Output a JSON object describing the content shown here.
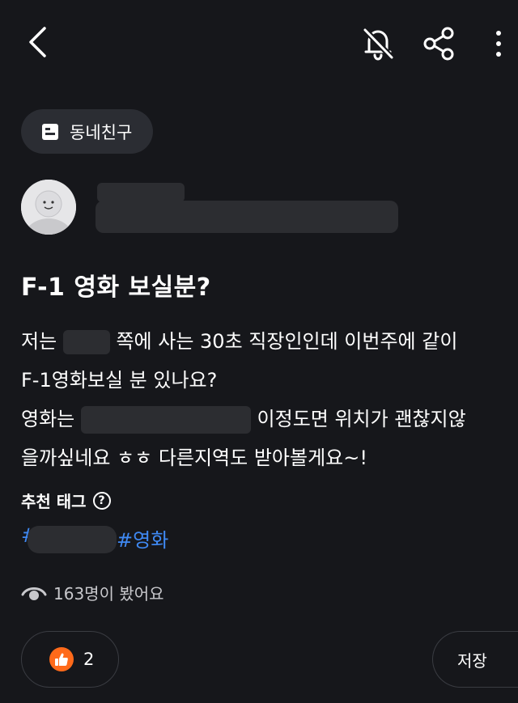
{
  "header": {
    "back_icon": "chevron-left-icon",
    "notification_icon": "bell-off-icon",
    "share_icon": "share-icon",
    "more_icon": "more-vertical-icon"
  },
  "category": {
    "label": "동네친구",
    "icon": "board-icon"
  },
  "post": {
    "title": "F-1 영화 보실분?",
    "body": {
      "line1_a": "저는",
      "line1_b": "쪽에 사는 30초 직장인인데 이번주에 같이",
      "line2": "F-1영화보실 분 있나요?",
      "line3_a": "영화는",
      "line3_b": "이정도면 위치가 괜찮지않",
      "line4": "을까싶네요 ㅎㅎ 다른지역도 받아볼게요~!"
    }
  },
  "tags": {
    "heading": "추천 태그",
    "help_icon": "question-circle-icon",
    "items": [
      "#",
      "#영화"
    ]
  },
  "stats": {
    "views": "163명이 봤어요",
    "eye_icon": "eye-icon"
  },
  "actions": {
    "like_count": "2",
    "like_icon": "thumbs-up-icon",
    "save_label": "저장"
  },
  "colors": {
    "background": "#16171b",
    "chip": "#2b2d33",
    "accent_link": "#3f89f3",
    "like": "#ff6a1a"
  }
}
